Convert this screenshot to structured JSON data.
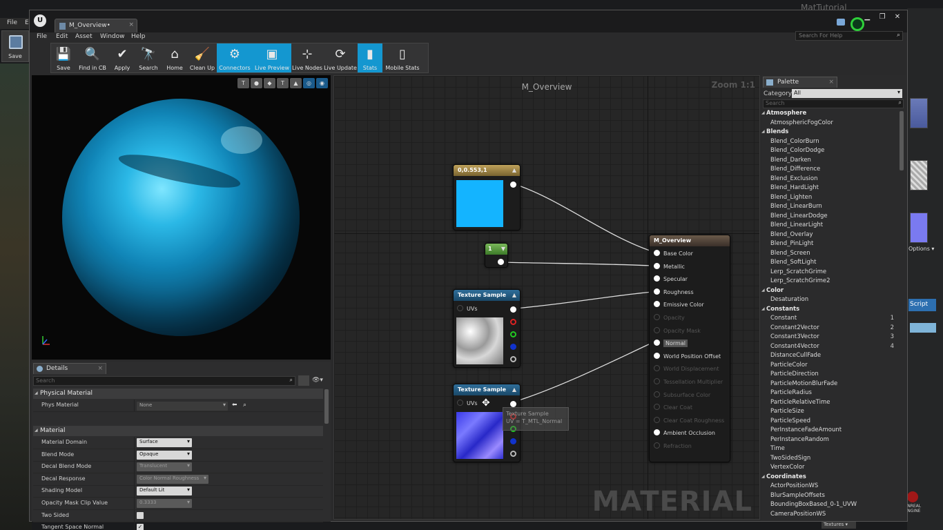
{
  "background": {
    "menu": [
      "File",
      "E"
    ],
    "save_label": "Save",
    "right_title": "MatTutorial",
    "options_label": "Options ▾",
    "script_label": "Script",
    "textures_label": "Textures ▾",
    "engine_logo": "UNREAL ENGINE"
  },
  "window": {
    "tab_title": "M_Overview•",
    "menu": [
      "File",
      "Edit",
      "Asset",
      "Window",
      "Help"
    ],
    "help_search_placeholder": "Search For Help",
    "controls": [
      "▁",
      "❐",
      "✕"
    ]
  },
  "toolbar": [
    {
      "label": "Save",
      "icon": "💾",
      "active": false
    },
    {
      "label": "Find in CB",
      "icon": "🔍",
      "active": false
    },
    {
      "label": "Apply",
      "icon": "✔",
      "active": false
    },
    {
      "label": "Search",
      "icon": "🔭",
      "active": false
    },
    {
      "label": "Home",
      "icon": "⌂",
      "active": false
    },
    {
      "label": "Clean Up",
      "icon": "🧹",
      "active": false
    },
    {
      "label": "Connectors",
      "icon": "⚙",
      "active": true
    },
    {
      "label": "Live Preview",
      "icon": "▣",
      "active": true
    },
    {
      "label": "Live Nodes",
      "icon": "⊹",
      "active": false
    },
    {
      "label": "Live Update",
      "icon": "⟳",
      "active": false
    },
    {
      "label": "Stats",
      "icon": "▮",
      "active": true
    },
    {
      "label": "Mobile Stats",
      "icon": "▯",
      "active": false
    }
  ],
  "viewport": {
    "icons": [
      "T",
      "●",
      "◆",
      "T",
      "▲",
      "◎",
      "◉"
    ]
  },
  "details": {
    "tab_label": "Details",
    "search_placeholder": "Search",
    "physical_material_category": "Physical Material",
    "phys_material_label": "Phys Material",
    "phys_material_value": "None",
    "material_category": "Material",
    "rows": [
      {
        "label": "Material Domain",
        "value": "Surface",
        "disabled": false
      },
      {
        "label": "Blend Mode",
        "value": "Opaque",
        "disabled": false
      },
      {
        "label": "Decal Blend Mode",
        "value": "Translucent",
        "disabled": true
      },
      {
        "label": "Decal Response",
        "value": "Color Normal Roughness",
        "disabled": true
      },
      {
        "label": "Shading Model",
        "value": "Default Lit",
        "disabled": false
      },
      {
        "label": "Opacity Mask Clip Value",
        "value": "0.3333",
        "disabled": true
      },
      {
        "label": "Two Sided",
        "value": "",
        "disabled": false
      },
      {
        "label": "Tangent Space Normal",
        "value": "✓",
        "disabled": false
      }
    ]
  },
  "graph": {
    "title": "M_Overview",
    "zoom": "Zoom 1:1",
    "watermark": "MATERIAL",
    "constant_color": {
      "header": "0,0.553,1",
      "swatch": "#14b4ff"
    },
    "constant": {
      "header": "1"
    },
    "texture1": {
      "header": "Texture Sample",
      "uvs": "UVs"
    },
    "texture2": {
      "header": "Texture Sample",
      "uvs": "UVs"
    },
    "tooltip": {
      "line1": "Texture Sample",
      "line2": "UV = T_MTL_Normal"
    },
    "output": {
      "header": "M_Overview",
      "pins": [
        {
          "label": "Base Color",
          "enabled": true
        },
        {
          "label": "Metallic",
          "enabled": true
        },
        {
          "label": "Specular",
          "enabled": true
        },
        {
          "label": "Roughness",
          "enabled": true
        },
        {
          "label": "Emissive Color",
          "enabled": true
        },
        {
          "label": "Opacity",
          "enabled": false
        },
        {
          "label": "Opacity Mask",
          "enabled": false
        },
        {
          "label": "Normal",
          "enabled": true
        },
        {
          "label": "World Position Offset",
          "enabled": true
        },
        {
          "label": "World Displacement",
          "enabled": false
        },
        {
          "label": "Tessellation Multiplier",
          "enabled": false
        },
        {
          "label": "Subsurface Color",
          "enabled": false
        },
        {
          "label": "Clear Coat",
          "enabled": false
        },
        {
          "label": "Clear Coat Roughness",
          "enabled": false
        },
        {
          "label": "Ambient Occlusion",
          "enabled": true
        },
        {
          "label": "Refraction",
          "enabled": false
        }
      ]
    }
  },
  "palette": {
    "tab_label": "Palette",
    "category_label": "Category:",
    "category_value": "All",
    "search_placeholder": "Search",
    "items": [
      {
        "t": "Atmosphere",
        "cat": true
      },
      {
        "t": "AtmosphericFogColor"
      },
      {
        "t": "Blends",
        "cat": true
      },
      {
        "t": "Blend_ColorBurn"
      },
      {
        "t": "Blend_ColorDodge"
      },
      {
        "t": "Blend_Darken"
      },
      {
        "t": "Blend_Difference"
      },
      {
        "t": "Blend_Exclusion"
      },
      {
        "t": "Blend_HardLight"
      },
      {
        "t": "Blend_Lighten"
      },
      {
        "t": "Blend_LinearBurn"
      },
      {
        "t": "Blend_LinearDodge"
      },
      {
        "t": "Blend_LinearLight"
      },
      {
        "t": "Blend_Overlay"
      },
      {
        "t": "Blend_PinLight"
      },
      {
        "t": "Blend_Screen"
      },
      {
        "t": "Blend_SoftLight"
      },
      {
        "t": "Lerp_ScratchGrime"
      },
      {
        "t": "Lerp_ScratchGrime2"
      },
      {
        "t": "Color",
        "cat": true
      },
      {
        "t": "Desaturation"
      },
      {
        "t": "Constants",
        "cat": true
      },
      {
        "t": "Constant",
        "n": "1"
      },
      {
        "t": "Constant2Vector",
        "n": "2"
      },
      {
        "t": "Constant3Vector",
        "n": "3"
      },
      {
        "t": "Constant4Vector",
        "n": "4"
      },
      {
        "t": "DistanceCullFade"
      },
      {
        "t": "ParticleColor"
      },
      {
        "t": "ParticleDirection"
      },
      {
        "t": "ParticleMotionBlurFade"
      },
      {
        "t": "ParticleRadius"
      },
      {
        "t": "ParticleRelativeTime"
      },
      {
        "t": "ParticleSize"
      },
      {
        "t": "ParticleSpeed"
      },
      {
        "t": "PerInstanceFadeAmount"
      },
      {
        "t": "PerInstanceRandom"
      },
      {
        "t": "Time"
      },
      {
        "t": "TwoSidedSign"
      },
      {
        "t": "VertexColor"
      },
      {
        "t": "Coordinates",
        "cat": true
      },
      {
        "t": "ActorPositionWS"
      },
      {
        "t": "BlurSampleOffsets"
      },
      {
        "t": "BoundingBoxBased_0-1_UVW"
      },
      {
        "t": "CameraPositionWS"
      }
    ]
  }
}
